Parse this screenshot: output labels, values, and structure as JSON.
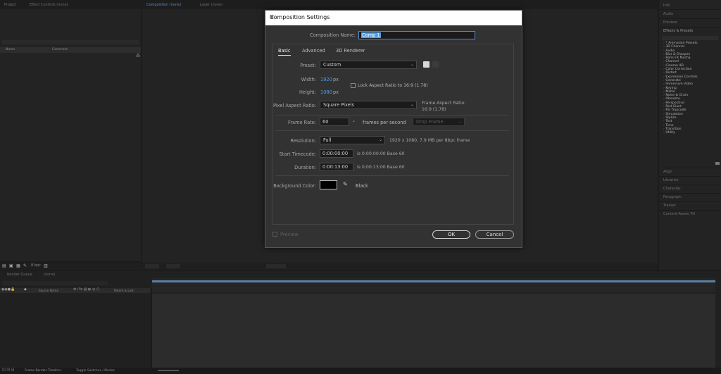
{
  "left_top_panel": {
    "tabs": [
      "Project",
      "Effect Controls (none)"
    ],
    "search_placeholder": "",
    "columns": [
      "Name",
      "Comment"
    ]
  },
  "comp_viewer": {
    "tabs": [
      "Composition (none)",
      "Layer (none)"
    ]
  },
  "right_panel": {
    "tabs_top": [
      "Info",
      "Audio",
      "Preview",
      "Effects & Presets"
    ],
    "effects": [
      "* Animation Presets",
      "3D Channel",
      "Audio",
      "Blur & Sharpen",
      "Boris FX Mocha",
      "Channel",
      "Cinema 4D",
      "Color Correction",
      "Distort",
      "Expression Controls",
      "Generate",
      "Immersive Video",
      "Keying",
      "Matte",
      "Noise & Grain",
      "Obsolete",
      "Perspective",
      "Red Giant",
      "RG Trapcode",
      "Simulation",
      "Stylize",
      "Text",
      "Time",
      "Transition",
      "Utility"
    ],
    "tabs_bottom": [
      "Align",
      "Libraries",
      "Character",
      "Paragraph",
      "Tracker",
      "Content-Aware Fill"
    ]
  },
  "dialog": {
    "title": "Composition Settings",
    "comp_name_label": "Composition Name:",
    "comp_name_value": "Comp 1",
    "tabs": [
      "Basic",
      "Advanced",
      "3D Renderer"
    ],
    "preset_label": "Preset:",
    "preset_value": "Custom",
    "width_label": "Width:",
    "width_value": "1920",
    "height_label": "Height:",
    "height_value": "1080",
    "px_unit": "px",
    "lock_aspect_label": "Lock Aspect Ratio to 16:9 (1.78)",
    "par_label": "Pixel Aspect Ratio:",
    "par_value": "Square Pixels",
    "frame_aspect_label": "Frame Aspect Ratio:",
    "frame_aspect_value": "16:9 (1.78)",
    "frame_rate_label": "Frame Rate:",
    "frame_rate_value": "60",
    "fps_label": "frames per second",
    "drop_frame": "Drop Frame",
    "resolution_label": "Resolution:",
    "resolution_value": "Full",
    "resolution_info": "1920 x 1080, 7.9 MB per 8bpc frame",
    "start_tc_label": "Start Timecode:",
    "start_tc_value": "0:00:00:00",
    "start_tc_info": "is 0:00:00:00  Base 60",
    "duration_label": "Duration:",
    "duration_value": "0:00:13:00",
    "duration_info": "is 0:00:13:00  Base 60",
    "bg_color_label": "Background Color:",
    "bg_color_name": "Black",
    "bg_color_hex": "#000000",
    "preview_label": "Preview",
    "ok_label": "OK",
    "cancel_label": "Cancel"
  },
  "timeline": {
    "tabs": [
      "Render Queue",
      "(none)"
    ],
    "columns": [
      "Source Name",
      "Parent & Link"
    ],
    "footer": {
      "frame_render_time": "Frame Render Time",
      "frame_render_value": "0ms",
      "toggle": "Toggle Switches / Modes"
    }
  },
  "colors": {
    "accent": "#4e9ee8",
    "timeline_bar": "#5b7fa8"
  }
}
